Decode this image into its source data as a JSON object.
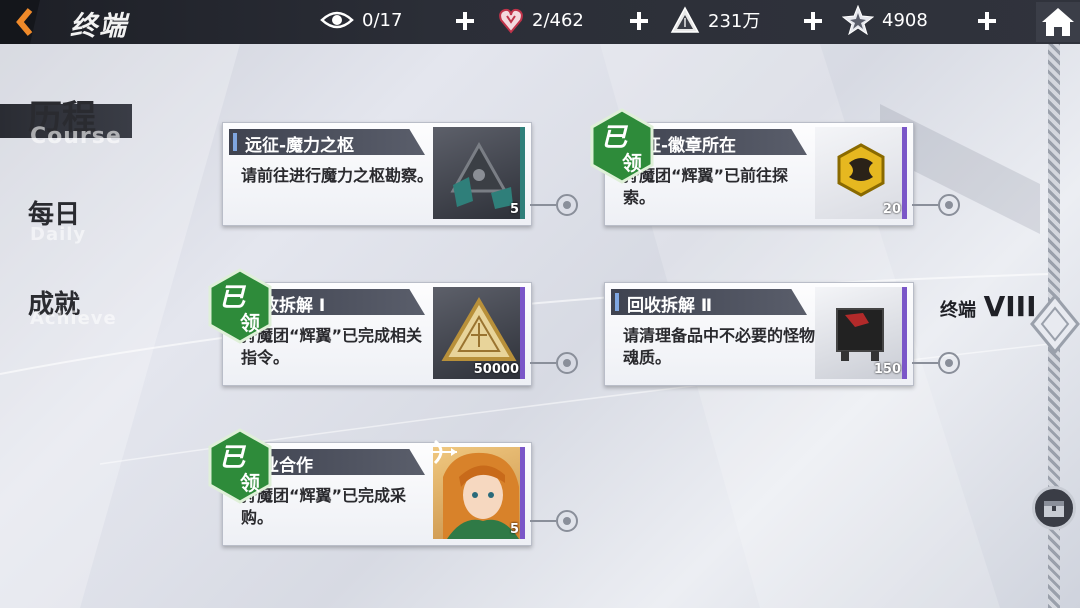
{
  "header": {
    "title": "终端",
    "resources": [
      {
        "icon": "eye-icon",
        "value": "0/17"
      },
      {
        "icon": "heart-crystal-icon",
        "value": "2/462"
      },
      {
        "icon": "pyramid-coin-icon",
        "value": "231万"
      },
      {
        "icon": "star-gem-icon",
        "value": "4908"
      }
    ]
  },
  "nav": {
    "items": [
      {
        "label": "历程",
        "sub": "Course",
        "active": true
      },
      {
        "label": "每日",
        "sub": "Daily",
        "active": false
      },
      {
        "label": "成就",
        "sub": "Achieve",
        "active": false
      }
    ]
  },
  "cards": [
    {
      "title": "远征-魔力之枢",
      "desc": "请前往进行魔力之枢勘察。",
      "reward_icon": "triangle-core-icon",
      "reward_count": "5",
      "claimed": false
    },
    {
      "title": "远征-徽章所在",
      "desc": "狩魔团“辉翼”已前往探索。",
      "reward_icon": "gold-badge-icon",
      "reward_count": "20",
      "claimed": true
    },
    {
      "title": "回收拆解 Ⅰ",
      "desc": "狩魔团“辉翼”已完成相关指令。",
      "reward_icon": "gold-triangle-icon",
      "reward_count": "50000",
      "claimed": true
    },
    {
      "title": "回收拆解 Ⅱ",
      "desc": "请清理备品中不必要的怪物魂质。",
      "reward_icon": "chip-icon",
      "reward_count": "150",
      "claimed": false
    },
    {
      "title": "专业合作",
      "desc": "狩魔团“辉翼”已完成采购。",
      "reward_icon": "character-portrait-icon",
      "reward_count": "5",
      "claimed": true
    }
  ],
  "claimed_badge": {
    "line1": "已",
    "line2": "领"
  },
  "terminal": {
    "label": "终端",
    "roman": "VIII"
  },
  "colors": {
    "accent": "#f08a2a",
    "claimed_green": "#2e8b3a",
    "reward_edge": "#7a56c8"
  }
}
